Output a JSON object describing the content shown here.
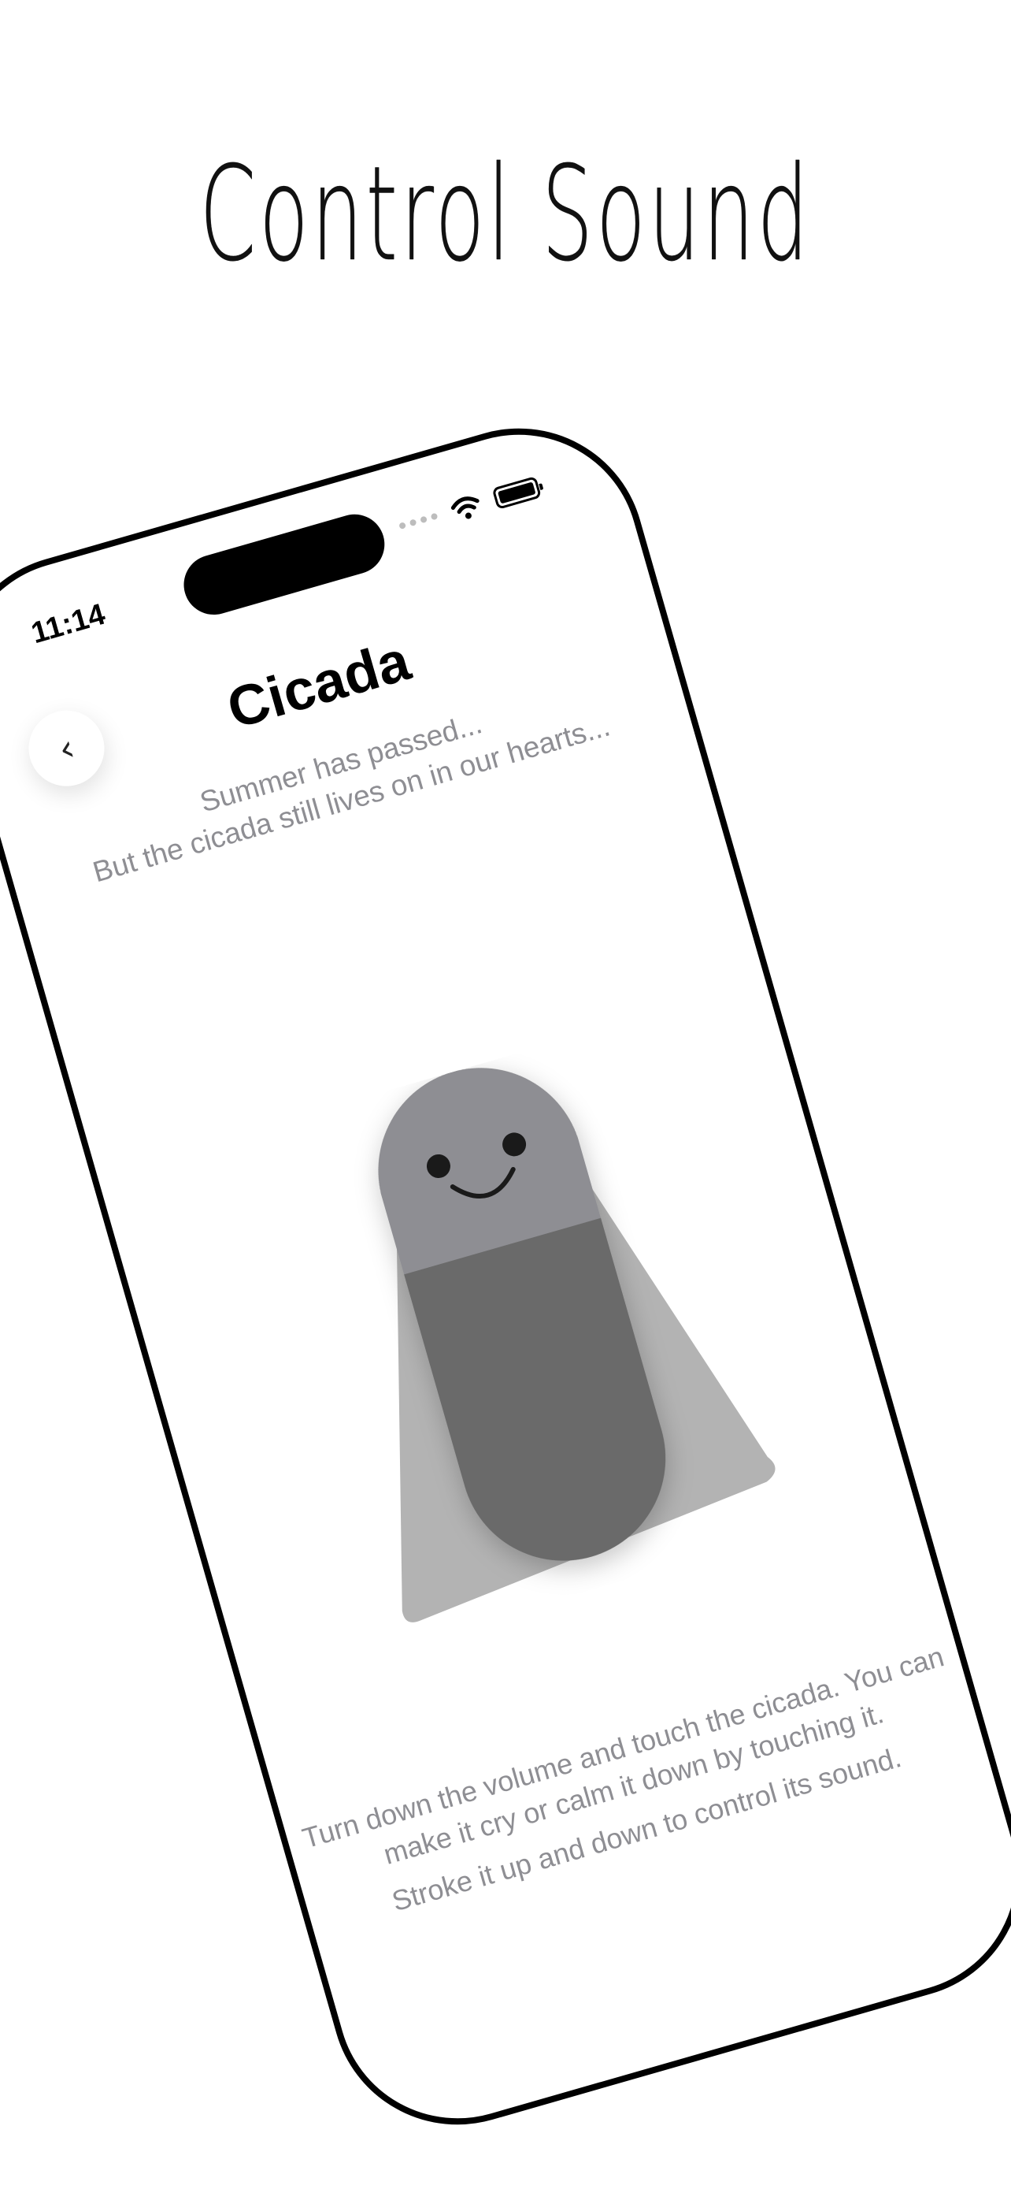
{
  "hero": {
    "title": "Control Sound"
  },
  "status_bar": {
    "time": "11:14"
  },
  "screen": {
    "back_icon": "chevron-left-icon",
    "back_glyph": "‹",
    "title": "Cicada",
    "subtitle_line1": "Summer has passed...",
    "subtitle_line2": "But the cicada still lives on in our hearts...",
    "instruction_1": "Turn down the volume and touch the cicada. You can make it cry or calm it down by touching it.",
    "instruction_2": "Stroke it up and down to control its sound."
  },
  "colors": {
    "body_light": "#8e8e93",
    "body_dark": "#6a6a6a",
    "wings": "#b3b3b3",
    "face": "#1a1a1a"
  }
}
